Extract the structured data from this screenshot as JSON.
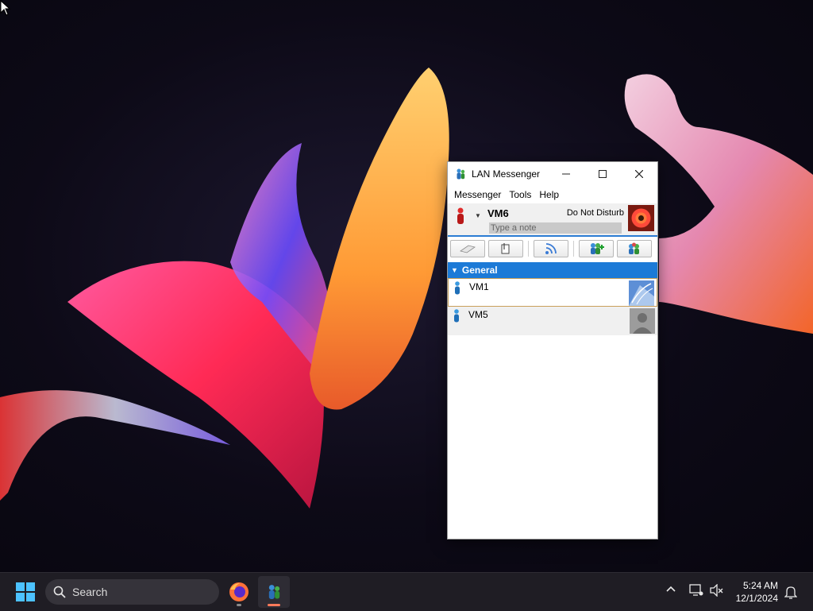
{
  "window": {
    "title": "LAN Messenger",
    "menu": [
      "Messenger",
      "Tools",
      "Help"
    ],
    "user": {
      "name": "VM6",
      "status": "Do Not Disturb",
      "note_placeholder": "Type a note",
      "note_value": ""
    },
    "toolbar_icons": [
      "broadcast-icon",
      "file-transfer-icon",
      "public-feed-icon",
      "add-contact-icon",
      "group-chat-icon"
    ],
    "group": {
      "name": "General",
      "contacts": [
        {
          "name": "VM1",
          "selected": true
        },
        {
          "name": "VM5",
          "selected": false
        }
      ]
    }
  },
  "taskbar": {
    "search_label": "Search",
    "clock": {
      "time": "5:24 AM",
      "date": "12/1/2024"
    },
    "apps": [
      "firefox-icon",
      "lan-messenger-icon"
    ]
  },
  "colors": {
    "accent": "#1c7ad7",
    "status_dnd": "#cc1f1f",
    "taskbar": "#1f1d24"
  }
}
